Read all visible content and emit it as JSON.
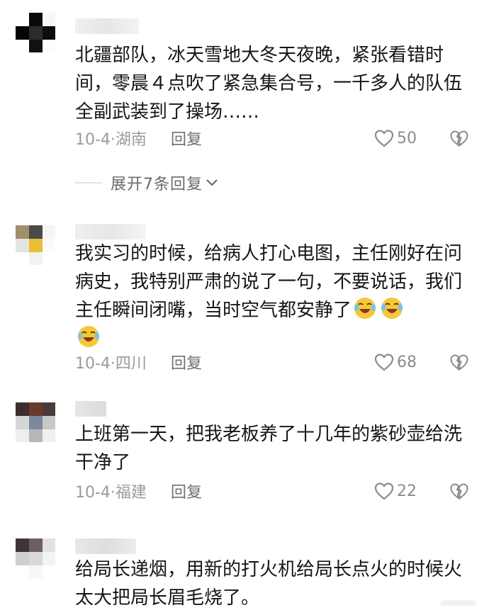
{
  "comments": [
    {
      "text": "北疆部队，冰天雪地大冬天夜晚，紧张看错时间，零晨４点吹了紧急集合号，一千多人的队伍全副武装到了操场……",
      "date_location": "10-4·湖南",
      "reply_label": "回复",
      "likes": "50"
    },
    {
      "text": "我实习的时候，给病人打心电图，主任刚好在问病史，我特别严肃的说了一句，不要说话，我们主任瞬间闭嘴，当时空气都安静了",
      "emoji_count": 3,
      "emoji_name": "laughing-crying-emoji",
      "date_location": "10-4·四川",
      "reply_label": "回复",
      "likes": "68"
    },
    {
      "text": "上班第一天，把我老板养了十几年的紫砂壶给洗干净了",
      "date_location": "10-4·福建",
      "reply_label": "回复",
      "likes": "22"
    },
    {
      "text": "给局长递烟，用新的打火机给局长点火的时候火太大把局长眉毛烧了。"
    }
  ],
  "expand_replies": {
    "label": "展开7条回复"
  },
  "icons": {
    "like": "heart-outline-icon",
    "dislike": "broken-heart-icon",
    "expand": "chevron-down-icon"
  },
  "colors": {
    "text": "#161616",
    "meta": "#9b9b9b",
    "icon": "#8c8c8c"
  }
}
